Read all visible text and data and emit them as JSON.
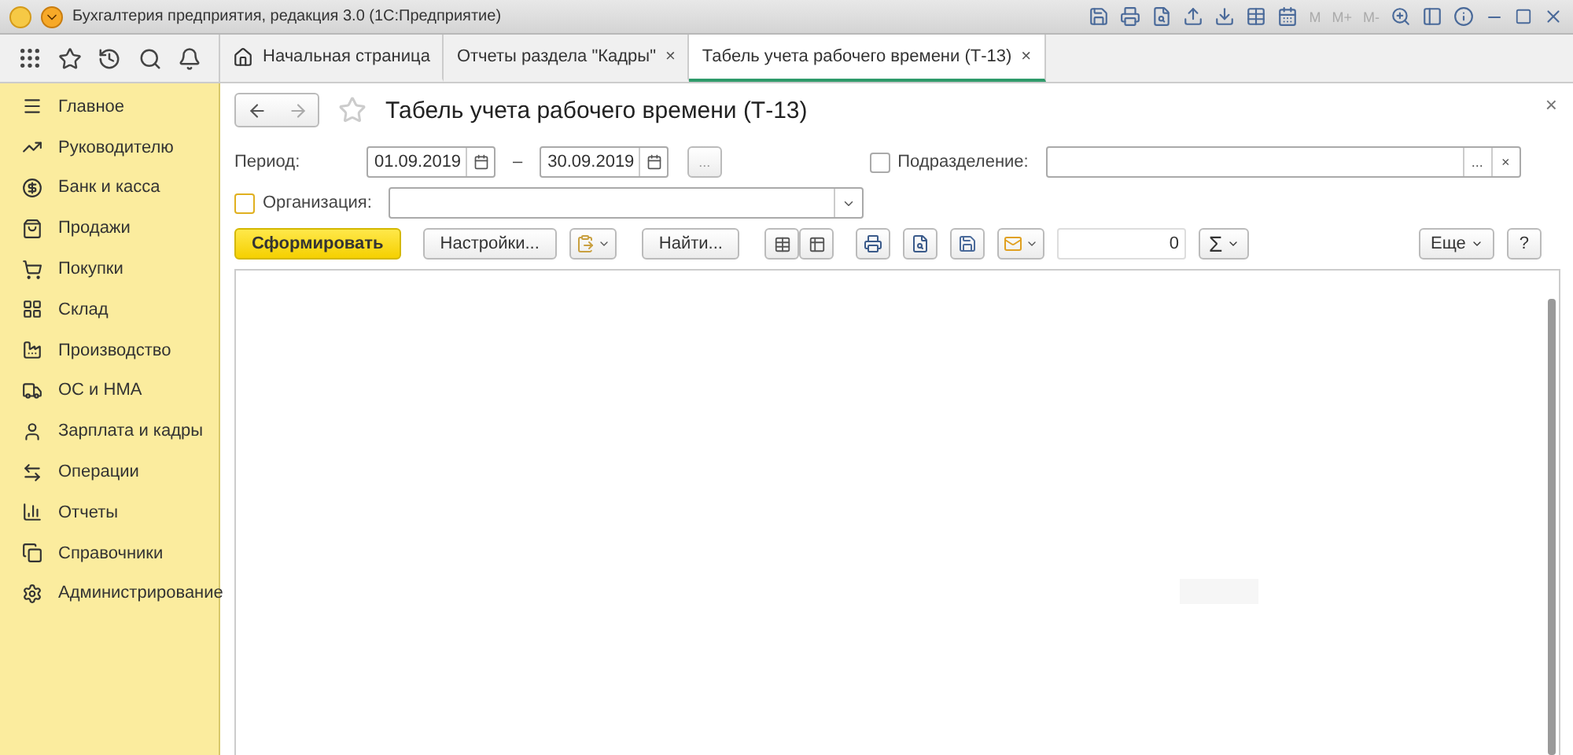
{
  "window": {
    "title": "Бухгалтерия предприятия, редакция 3.0  (1С:Предприятие)",
    "memory_buttons": [
      "M",
      "M+",
      "M-"
    ]
  },
  "tabs": [
    {
      "label": "Начальная страница",
      "kind": "home",
      "selected": false
    },
    {
      "label": "Отчеты раздела \"Кадры\"",
      "kind": "closable",
      "close": "×",
      "selected": false
    },
    {
      "label": "Табель учета рабочего времени (Т-13)",
      "kind": "closable",
      "close": "×",
      "selected": true
    }
  ],
  "sidebar": {
    "items": [
      {
        "label": "Главное"
      },
      {
        "label": "Руководителю"
      },
      {
        "label": "Банк и касса"
      },
      {
        "label": "Продажи"
      },
      {
        "label": "Покупки"
      },
      {
        "label": "Склад"
      },
      {
        "label": "Производство"
      },
      {
        "label": "ОС и НМА"
      },
      {
        "label": "Зарплата и кадры"
      },
      {
        "label": "Операции"
      },
      {
        "label": "Отчеты"
      },
      {
        "label": "Справочники"
      },
      {
        "label": "Администрирование"
      }
    ]
  },
  "form": {
    "title": "Табель учета рабочего времени (Т-13)",
    "close": "×",
    "period": {
      "label": "Период:",
      "from": "01.09.2019",
      "dash": "–",
      "to": "30.09.2019",
      "more": "..."
    },
    "department": {
      "label": "Подразделение:",
      "checked": false,
      "more": "...",
      "clear": "×"
    },
    "organization": {
      "label": "Организация:",
      "checked": false
    },
    "toolbar": {
      "generate": "Сформировать",
      "settings": "Настройки...",
      "find": "Найти...",
      "sum_value": "0",
      "sigma": "Σ",
      "more": "Еще",
      "help": "?"
    }
  }
}
